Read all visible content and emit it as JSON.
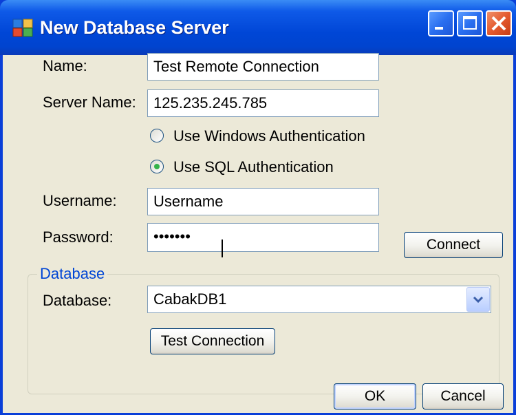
{
  "window": {
    "title": "New Database Server"
  },
  "form": {
    "name_label": "Name:",
    "name_value": "Test Remote Connection",
    "server_label": "Server Name:",
    "server_value": "125.235.245.785",
    "auth_options": [
      {
        "label": "Use Windows Authentication",
        "selected": false
      },
      {
        "label": "Use SQL Authentication",
        "selected": true
      }
    ],
    "username_label": "Username:",
    "username_value": "Username",
    "password_label": "Password:",
    "password_value": "•••••••",
    "connect_label": "Connect"
  },
  "database_group": {
    "title": "Database",
    "db_label": "Database:",
    "db_selected": "CabakDB1",
    "test_connection_label": "Test Connection"
  },
  "footer": {
    "ok_label": "OK",
    "cancel_label": "Cancel"
  },
  "colors": {
    "titlebar": "#0046d6",
    "face": "#ece9d8",
    "group_title": "#0046d5",
    "radio_dot": "#35b34a"
  }
}
